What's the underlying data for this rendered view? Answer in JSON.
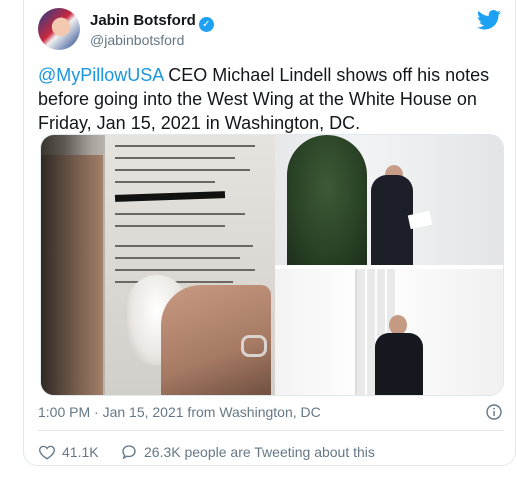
{
  "author": {
    "name": "Jabin Botsford",
    "handle": "@jabinbotsford"
  },
  "tweet": {
    "mention": "@MyPillowUSA",
    "text": " CEO Michael Lindell shows off his notes before going into the West Wing at the White House on Friday, Jan 15, 2021 in Washington, DC."
  },
  "meta": {
    "time_location": "1:00 PM · Jan 15, 2021 from Washington, DC"
  },
  "stats": {
    "likes": "41.1K",
    "tweeting": "26.3K people are Tweeting about this"
  },
  "colors": {
    "accent": "#1da1f2",
    "mention": "#1b95e0",
    "muted": "#657786"
  },
  "icons": [
    "verified-badge-icon",
    "twitter-bird-icon",
    "info-icon",
    "heart-icon",
    "comment-icon"
  ]
}
